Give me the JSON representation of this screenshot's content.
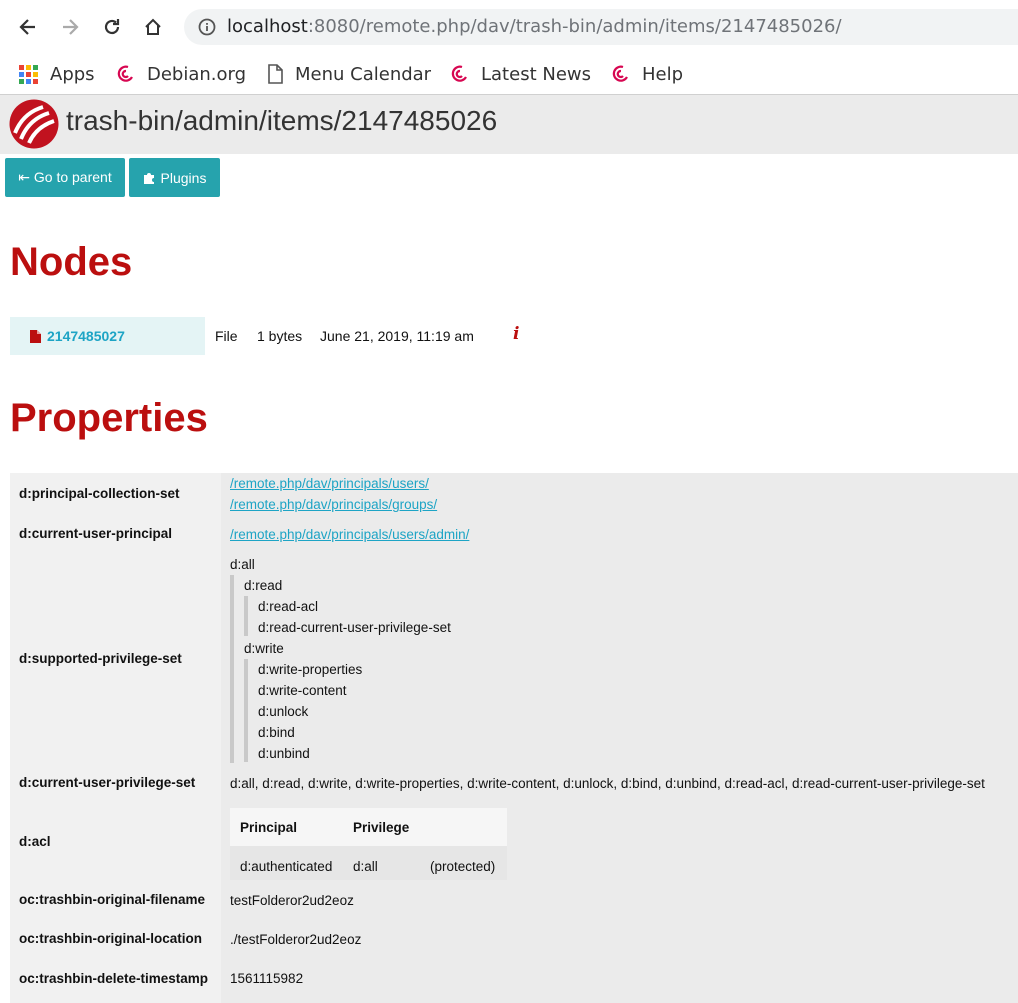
{
  "browser": {
    "url_host": "localhost",
    "url_rest": ":8080/remote.php/dav/trash-bin/admin/items/2147485026/",
    "bookmarks": [
      {
        "label": "Apps",
        "icon": "apps-grid-icon"
      },
      {
        "label": "Debian.org",
        "icon": "debian-swirl-icon"
      },
      {
        "label": "Menu Calendar",
        "icon": "page-icon"
      },
      {
        "label": "Latest News",
        "icon": "debian-swirl-icon"
      },
      {
        "label": "Help",
        "icon": "debian-swirl-icon"
      }
    ]
  },
  "header": {
    "title": "trash-bin/admin/items/2147485026"
  },
  "buttons": {
    "parent": "⇤ Go to parent",
    "plugins": "Plugins"
  },
  "nodes": {
    "heading": "Nodes",
    "items": [
      {
        "name": "2147485027",
        "type": "File",
        "size": "1 bytes",
        "modified": "June 21, 2019, 11:19 am",
        "info_icon": "i"
      }
    ]
  },
  "properties": {
    "heading": "Properties",
    "principal_collection_set": {
      "key": "d:principal-collection-set",
      "values": [
        "/remote.php/dav/principals/users/",
        "/remote.php/dav/principals/groups/"
      ]
    },
    "current_user_principal": {
      "key": "d:current-user-principal",
      "value": "/remote.php/dav/principals/users/admin/"
    },
    "supported_privilege_set": {
      "key": "d:supported-privilege-set",
      "root": "d:all",
      "read": "d:read",
      "read_children": [
        "d:read-acl",
        "d:read-current-user-privilege-set"
      ],
      "write": "d:write",
      "write_children": [
        "d:write-properties",
        "d:write-content",
        "d:unlock",
        "d:bind",
        "d:unbind"
      ]
    },
    "current_user_privilege_set": {
      "key": "d:current-user-privilege-set",
      "value": "d:all, d:read, d:write, d:write-properties, d:write-content, d:unlock, d:bind, d:unbind, d:read-acl, d:read-current-user-privilege-set"
    },
    "acl": {
      "key": "d:acl",
      "headers": [
        "Principal",
        "Privilege"
      ],
      "row": {
        "principal": "d:authenticated",
        "privilege": "d:all",
        "note": "(protected)"
      }
    },
    "original_filename": {
      "key": "oc:trashbin-original-filename",
      "value": "testFolderor2ud2eoz"
    },
    "original_location": {
      "key": "oc:trashbin-original-location",
      "value": "./testFolderor2ud2eoz"
    },
    "delete_timestamp": {
      "key": "oc:trashbin-delete-timestamp",
      "value": "1561115982"
    }
  },
  "colors": {
    "heading_red": "#bb0f0f",
    "button_teal": "#26a3ad",
    "link_blue": "#1da4c5"
  }
}
